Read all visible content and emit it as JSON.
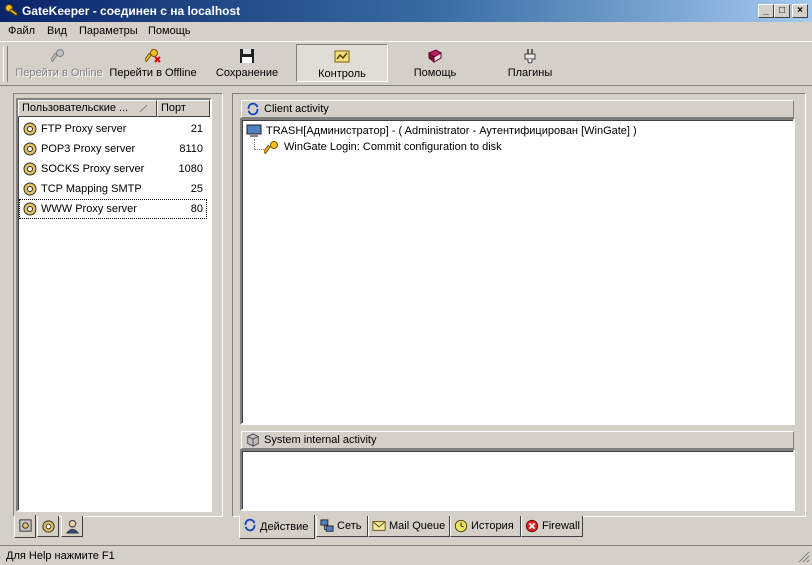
{
  "window": {
    "title": "GateKeeper - соединен с на localhost"
  },
  "menu": [
    "Файл",
    "Вид",
    "Параметры",
    "Помощь"
  ],
  "toolbar": [
    {
      "label": "Перейти в Online",
      "icon": "key-icon",
      "state": "disabled"
    },
    {
      "label": "Перейти в Offline",
      "icon": "key-off-icon",
      "state": "normal"
    },
    {
      "label": "Сохранение",
      "icon": "floppy-icon",
      "state": "normal"
    },
    {
      "label": "Контроль",
      "icon": "monitor-control-icon",
      "state": "pressed"
    },
    {
      "label": "Помощь",
      "icon": "help-book-icon",
      "state": "normal"
    },
    {
      "label": "Плагины",
      "icon": "plug-icon",
      "state": "normal"
    }
  ],
  "services": {
    "columns": [
      "Пользовательские ...",
      "Порт"
    ],
    "rows": [
      {
        "name": "FTP Proxy server",
        "port": "21"
      },
      {
        "name": "POP3 Proxy server",
        "port": "8110"
      },
      {
        "name": "SOCKS Proxy server",
        "port": "1080"
      },
      {
        "name": "TCP Mapping SMTP",
        "port": "25"
      },
      {
        "name": "WWW Proxy server",
        "port": "80",
        "selected": true
      }
    ]
  },
  "left_tabs": [
    "services-tab-icon",
    "gear-services-icon",
    "users-icon"
  ],
  "client_activity": {
    "header": "Client activity",
    "session": "TRASH[Администратор]  -  ( Administrator  -  Аутентифицирован [WinGate] )",
    "entry": "WinGate Login: Commit configuration to disk"
  },
  "system_activity": {
    "header": "System internal activity"
  },
  "bottom_tabs": [
    {
      "label": "Действие",
      "icon": "activity-icon",
      "active": true
    },
    {
      "label": "Сеть",
      "icon": "network-icon"
    },
    {
      "label": "Mail Queue",
      "icon": "mail-icon"
    },
    {
      "label": "История",
      "icon": "clock-icon"
    },
    {
      "label": "Firewall",
      "icon": "firewall-icon"
    }
  ],
  "status": {
    "text": "Для Help нажмите F1"
  },
  "colors": {
    "title_start": "#0a246a",
    "title_end": "#a6caf0",
    "face": "#d4d0c8"
  }
}
